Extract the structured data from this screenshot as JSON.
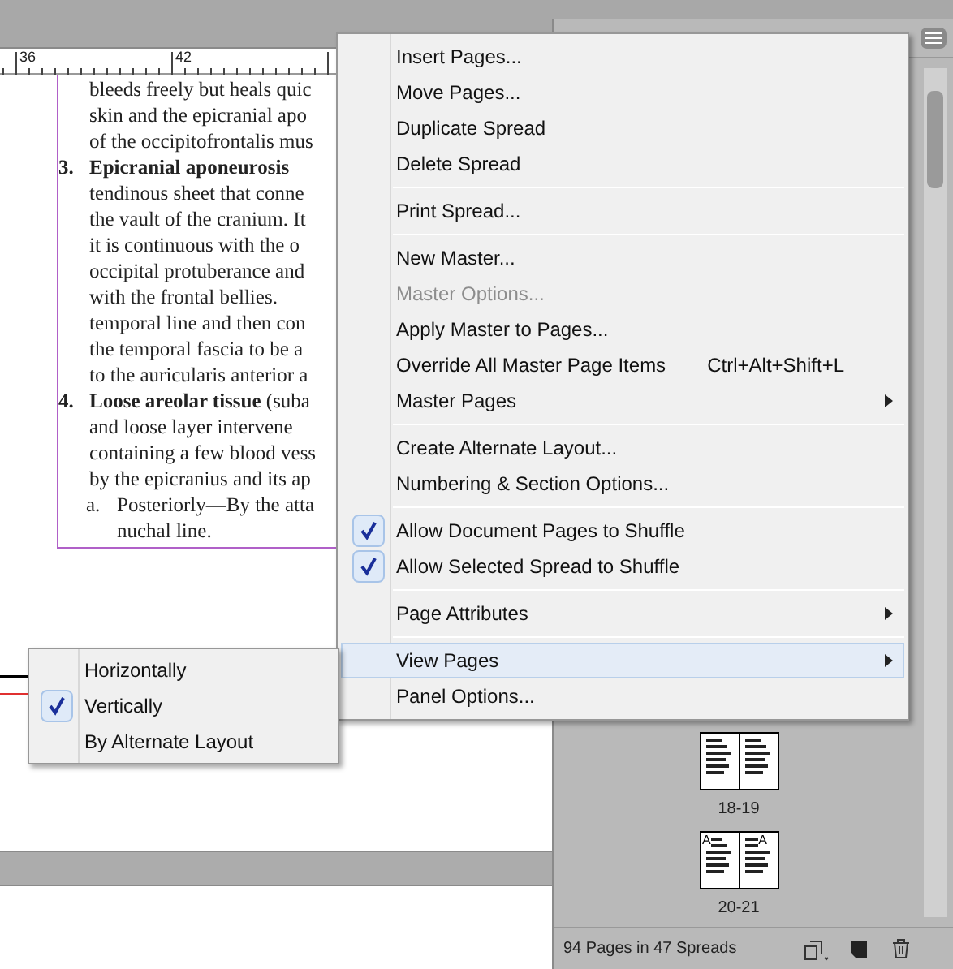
{
  "ruler": {
    "labels": [
      "36",
      "42"
    ]
  },
  "document": {
    "paragraphs": [
      {
        "lines": [
          "bleeds freely but heals quic",
          "skin and the epicranial apo",
          "of the occipitofrontalis mus"
        ]
      },
      {
        "marker": "3.",
        "lines": [
          "**Epicranial aponeurosis**",
          "tendinous sheet that conne",
          "the vault of the cranium. It",
          "it is continuous with the o",
          "occipital protuberance and",
          "with the frontal bellies.",
          "temporal line and then con",
          "the temporal fascia to be a",
          "to the auricularis anterior a"
        ]
      },
      {
        "marker": "4.",
        "lines": [
          "**Loose areolar tissue** (suba",
          "and loose layer intervene",
          "containing a few blood vess",
          "by the epicranius and its ap"
        ]
      },
      {
        "marker": "a.",
        "lines": [
          "Posteriorly—By the atta",
          "nuchal line."
        ]
      }
    ]
  },
  "pages_panel": {
    "spreads": [
      {
        "label": "18-19"
      },
      {
        "label": "20-21",
        "master_letters": [
          "A",
          "A"
        ]
      }
    ],
    "status": "94 Pages in 47 Spreads"
  },
  "menu": [
    {
      "kind": "item",
      "label": "Insert Pages...",
      "checked": false,
      "disabled": false,
      "submenu": false,
      "selected": false
    },
    {
      "kind": "item",
      "label": "Move Pages...",
      "checked": false,
      "disabled": false,
      "submenu": false,
      "selected": false
    },
    {
      "kind": "item",
      "label": "Duplicate Spread",
      "checked": false,
      "disabled": false,
      "submenu": false,
      "selected": false
    },
    {
      "kind": "item",
      "label": "Delete Spread",
      "checked": false,
      "disabled": false,
      "submenu": false,
      "selected": false
    },
    {
      "kind": "separator"
    },
    {
      "kind": "item",
      "label": "Print Spread...",
      "checked": false,
      "disabled": false,
      "submenu": false,
      "selected": false
    },
    {
      "kind": "separator"
    },
    {
      "kind": "item",
      "label": "New Master...",
      "checked": false,
      "disabled": false,
      "submenu": false,
      "selected": false
    },
    {
      "kind": "item",
      "label": "Master Options...",
      "checked": false,
      "disabled": true,
      "submenu": false,
      "selected": false
    },
    {
      "kind": "item",
      "label": "Apply Master to Pages...",
      "checked": false,
      "disabled": false,
      "submenu": false,
      "selected": false
    },
    {
      "kind": "item",
      "label": "Override All Master Page Items",
      "shortcut": "Ctrl+Alt+Shift+L",
      "checked": false,
      "disabled": false,
      "submenu": false,
      "selected": false
    },
    {
      "kind": "item",
      "label": "Master Pages",
      "checked": false,
      "disabled": false,
      "submenu": true,
      "selected": false
    },
    {
      "kind": "separator"
    },
    {
      "kind": "item",
      "label": "Create Alternate Layout...",
      "checked": false,
      "disabled": false,
      "submenu": false,
      "selected": false
    },
    {
      "kind": "item",
      "label": "Numbering & Section Options...",
      "checked": false,
      "disabled": false,
      "submenu": false,
      "selected": false
    },
    {
      "kind": "separator"
    },
    {
      "kind": "item",
      "label": "Allow Document Pages to Shuffle",
      "checked": true,
      "disabled": false,
      "submenu": false,
      "selected": false
    },
    {
      "kind": "item",
      "label": "Allow Selected Spread to Shuffle",
      "checked": true,
      "disabled": false,
      "submenu": false,
      "selected": false
    },
    {
      "kind": "separator"
    },
    {
      "kind": "item",
      "label": "Page Attributes",
      "checked": false,
      "disabled": false,
      "submenu": true,
      "selected": false
    },
    {
      "kind": "separator"
    },
    {
      "kind": "item",
      "label": "View Pages",
      "checked": false,
      "disabled": false,
      "submenu": true,
      "selected": true
    },
    {
      "kind": "item",
      "label": "Panel Options...",
      "checked": false,
      "disabled": false,
      "submenu": false,
      "selected": false
    }
  ],
  "submenu": [
    {
      "label": "Horizontally",
      "checked": false
    },
    {
      "label": "Vertically",
      "checked": true
    },
    {
      "label": "By Alternate Layout",
      "checked": false
    }
  ]
}
